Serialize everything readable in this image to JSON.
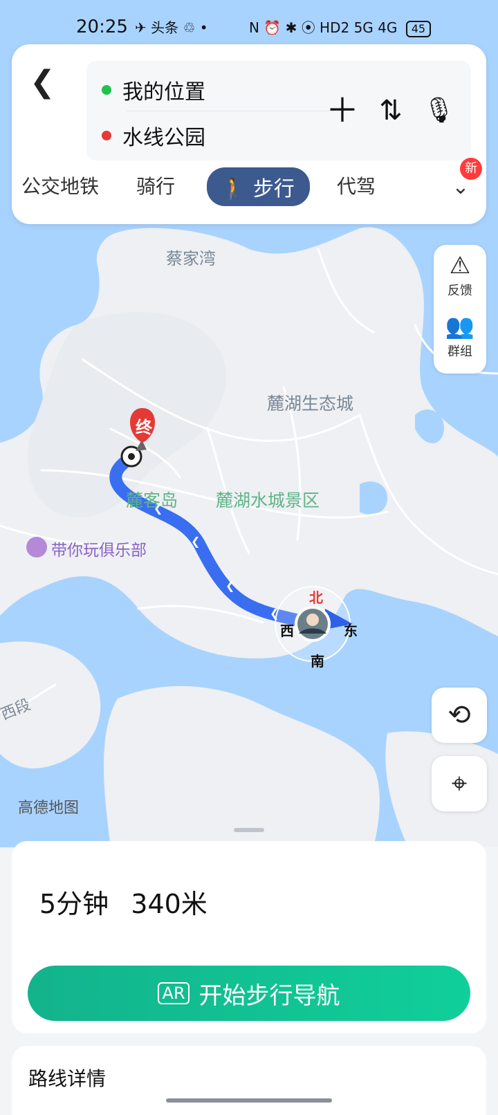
{
  "status_bar": {
    "time": "20:25",
    "left_icons": "✈ 头条 ♲ •",
    "right_icons": "N ⏰ ✱ ⦿ HD2 5G 4G",
    "battery": "45"
  },
  "search": {
    "origin": "我的位置",
    "destination": "水线公园",
    "origin_color": "#1ec34d",
    "destination_color": "#e53935"
  },
  "modes": {
    "items": [
      "公交地铁",
      "骑行",
      "步行",
      "代驾"
    ],
    "active": "步行",
    "new_badge": "新"
  },
  "side_tools": {
    "feedback": "反馈",
    "group": "群组"
  },
  "map": {
    "labels": {
      "cai_jia_wan": "蔡家湾",
      "lu_hu_eco_city": "麓湖生态城",
      "lu_ke_dao": "麓客岛",
      "lu_hu_scenic": "麓湖水城景区",
      "poi_club": "带你玩俱乐部",
      "west_section": "西段"
    },
    "end_marker": "终",
    "compass": {
      "north": "北",
      "south": "南",
      "east": "东",
      "west": "西"
    },
    "provider_logo": "高德地图"
  },
  "route": {
    "summary_time": "5分钟",
    "summary_distance": "340米",
    "start_button": "开始步行导航",
    "ar_label": "AR",
    "details_title": "路线详情"
  },
  "colors": {
    "water": "#a9d3ff",
    "land": "#eef0f3",
    "route": "#3a6ef0",
    "accent_green": "#13b38c",
    "active_mode": "#3d5a8f"
  }
}
